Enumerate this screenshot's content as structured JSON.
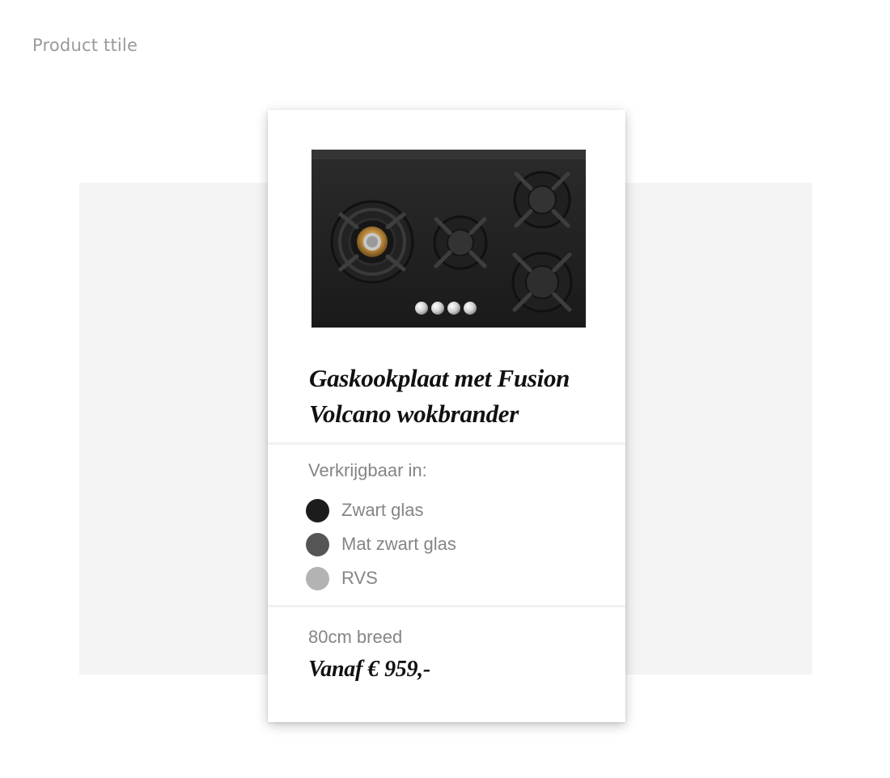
{
  "page": {
    "label": "Product ttile"
  },
  "card": {
    "title": "Gaskookplaat met Fusion Volcano wokbrander",
    "availability_label": "Verkrijgbaar in:",
    "finishes": [
      {
        "label": "Zwart glas",
        "color": "#1c1c1c"
      },
      {
        "label": "Mat zwart glas",
        "color": "#555555"
      },
      {
        "label": "RVS",
        "color": "#b3b3b3"
      }
    ],
    "width": "80cm breed",
    "price": "Vanaf € 959,-"
  }
}
